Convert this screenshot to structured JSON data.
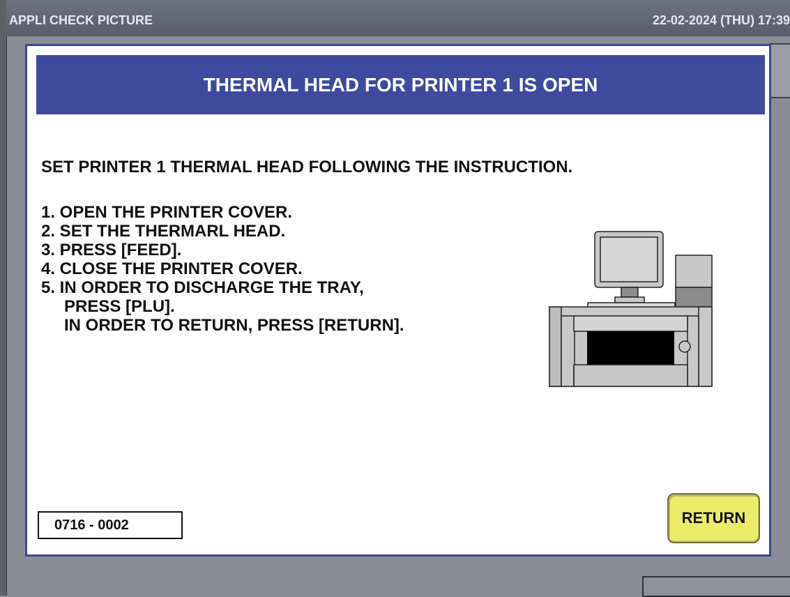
{
  "titlebar": {
    "app_title": "APPLI CHECK PICTURE",
    "datetime": "22-02-2024 (THU)  17:39"
  },
  "dialog": {
    "header": "THERMAL HEAD FOR PRINTER 1 IS OPEN",
    "instruction": "SET PRINTER 1 THERMAL HEAD FOLLOWING THE INSTRUCTION.",
    "steps": [
      "1. OPEN THE PRINTER COVER.",
      "2. SET THE THERMARL HEAD.",
      "3. PRESS [FEED].",
      "4. CLOSE THE PRINTER COVER.",
      "5. IN ORDER TO DISCHARGE THE TRAY,",
      "PRESS [PLU].",
      "IN ORDER TO RETURN, PRESS [RETURN]."
    ],
    "code": "0716 - 0002",
    "return_label": "RETURN",
    "illustration": "printer-scale-icon"
  },
  "colors": {
    "header_bg": "#3d4a9e",
    "return_button": "#ecec6a",
    "titlebar": "#5a5e6c"
  }
}
